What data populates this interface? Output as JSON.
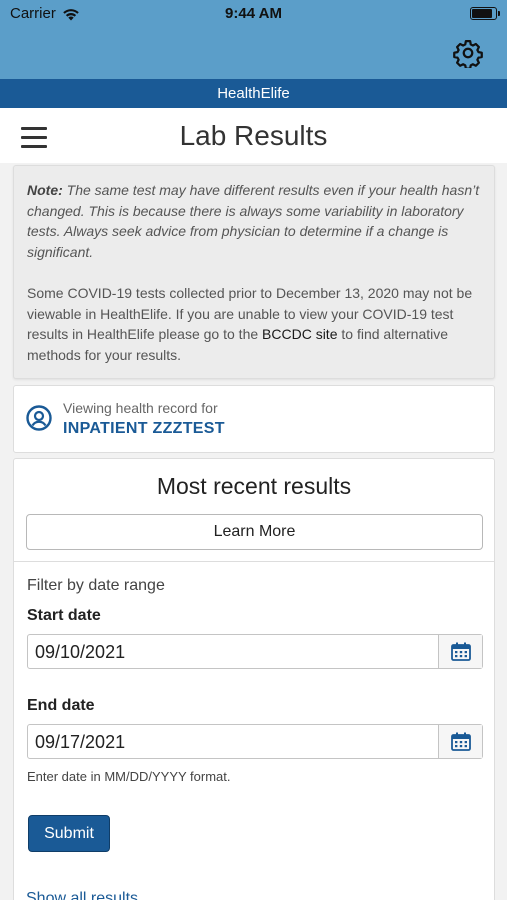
{
  "status_bar": {
    "carrier": "Carrier",
    "time": "9:44 AM"
  },
  "app": {
    "brand": "HealthElife"
  },
  "header": {
    "title": "Lab Results"
  },
  "note": {
    "label": "Note:",
    "text": "The same test may have different results even if your health hasn’t changed. This is because there is always some variability in laboratory tests. Always seek advice from physician to determine if a change is significant.",
    "covid_text_before": "Some COVID-19 tests collected prior to December 13, 2020 may not be viewable in HealthElife. If you are unable to view your COVID-19 test results in HealthElife please go to the ",
    "covid_link": "BCCDC site",
    "covid_text_after": " to find alternative methods for your results."
  },
  "record": {
    "label": "Viewing health record for",
    "name": "INPATIENT ZZZTEST"
  },
  "results": {
    "title": "Most recent results",
    "learn_more": "Learn More",
    "filter_label": "Filter by date range",
    "start_label": "Start date",
    "start_value": "09/10/2021",
    "end_label": "End date",
    "end_value": "09/17/2021",
    "hint": "Enter date in MM/DD/YYYY format.",
    "submit": "Submit",
    "show_all": "Show all results"
  },
  "icons": {
    "settings": "gear-icon",
    "menu": "hamburger-icon",
    "profile": "user-circle-icon",
    "calendar": "calendar-icon"
  },
  "colors": {
    "nav": "#5b9ec9",
    "brand": "#1a5a96",
    "accent": "#1a5a96"
  }
}
